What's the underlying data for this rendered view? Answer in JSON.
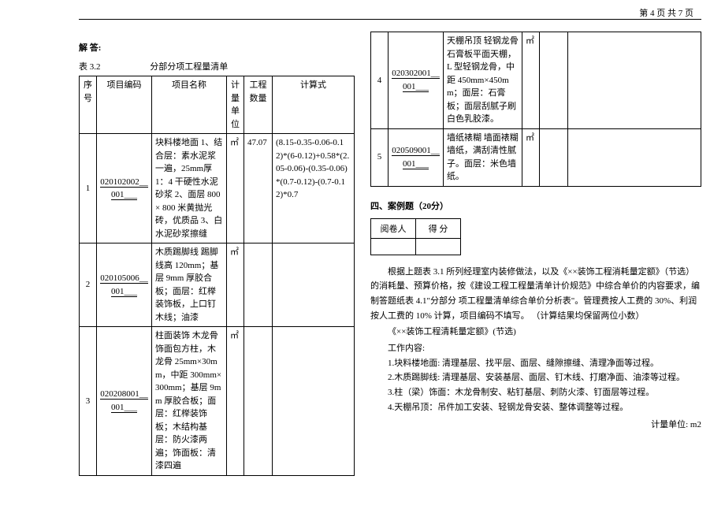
{
  "page_header": "第 4 页    共 7 页",
  "answer_label": "解 答:",
  "table_caption_num": "表 3.2",
  "table_caption_title": "分部分项工程量清单",
  "columns": {
    "seq": "序号",
    "code": "项目编码",
    "name": "项目名称",
    "unit": "计量单位",
    "qty": "工程数量",
    "formula": "计算式"
  },
  "rows": [
    {
      "seq": "1",
      "code": "020102002__001___",
      "name": "块料楼地面\n1、结合层：素水泥浆一遍，25mm厚 1：4 干硬性水泥砂浆  2、面层 800 × 800 米黄抛光砖，优质品 3、白水泥砂浆擦缝",
      "unit": "㎡",
      "qty": "47.07",
      "formula": "(8.15-0.35-0.06-0.12)*(6-0.12)+0.58*(2.05-0.06)-(0.35-0.06)*(0.7-0.12)-(0.7-0.12)*0.7"
    },
    {
      "seq": "2",
      "code": "020105006__001___",
      "name": "木质踢脚线\n踢脚线高 120mm；基层 9mm 厚胶合板；面层：红榉装饰板，上口钉木线；油漆",
      "unit": "㎡",
      "qty": "",
      "formula": ""
    },
    {
      "seq": "3",
      "code": "020208001__001___",
      "name": "柱面装饰\n木龙骨饰面包方柱，木龙骨 25mm×30mm，中距 300mm×300mm；基层 9mm 厚胶合板；面层：红榉装饰板；木结构基层：防火漆两遍；饰面板：清漆四遍",
      "unit": "㎡",
      "qty": "",
      "formula": ""
    },
    {
      "seq": "4",
      "code": "020302001__001___",
      "name": "天棚吊顶\n轻钢龙骨石膏板平面天棚，L 型轻钢龙骨，中距 450mm×450mm；面层：石膏板；面层刮腻子刷白色乳胶漆。",
      "unit": "㎡",
      "qty": "",
      "formula": ""
    },
    {
      "seq": "5",
      "code": "020509001__001___",
      "name": "墙纸裱糊\n墙面裱糊墙纸，满刮清性腻子。面层：米色墙纸。",
      "unit": "㎡",
      "qty": "",
      "formula": ""
    }
  ],
  "section4_title": "四、案例题（20分）",
  "score_labels": {
    "reviewer": "阅卷人",
    "score": "得  分"
  },
  "para1": "根据上题表 3.1 所列经理室内装修做法，以及《××装饰工程消耗量定额》（节选）的消耗量、预算价格，按《建设工程工程量清单计价规范》中综合单价的内容要求，编制答题纸表 4.1\"分部分  项工程量清单综合单价分析表\"。管理费按人工费的 30%、利润按人工费的 10% 计算，项目编码不填写。    （计算结果均保留两位小数）",
  "para2": "《××装饰工程清耗量定额》(节选)",
  "work_title": "工作内容:",
  "work_items": [
    "1.块料楼地面: 清理基层、找平层、面层、缝隙擦缝、清理净面等过程。",
    "2.木质踢脚线: 清理基层、安装基层、面层、钉木线、打磨净面、油漆等过程。",
    "3.柱（梁）饰面：木龙骨制安、粘钉基层、刺防火漆、钉面层等过程。",
    "4.天棚吊顶：吊件加工安装、轻钢龙骨安装、整体调整等过程。"
  ],
  "unit_line": "计量单位: m2"
}
